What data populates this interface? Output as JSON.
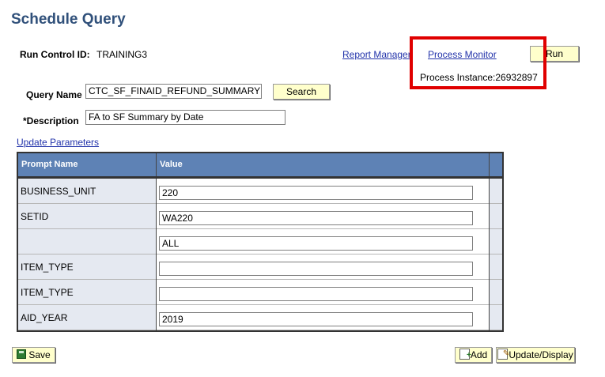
{
  "page": {
    "title": "Schedule Query"
  },
  "run_control": {
    "label": "Run Control ID:",
    "value": "TRAINING3"
  },
  "links": {
    "report_manager": "Report Manager",
    "process_monitor": "Process Monitor",
    "update_parameters": "Update Parameters"
  },
  "run_button": {
    "label": "Run"
  },
  "process_instance": {
    "text": "Process Instance:26932897"
  },
  "query_name": {
    "label": "Query Name",
    "value": "CTC_SF_FINAID_REFUND_SUMMARY"
  },
  "search_button": {
    "label": "Search"
  },
  "description": {
    "label": "*Description",
    "value": "FA to SF Summary by Date"
  },
  "grid": {
    "headers": {
      "prompt_name": "Prompt Name",
      "value": "Value"
    },
    "rows": [
      {
        "prompt": "BUSINESS_UNIT",
        "value": "220"
      },
      {
        "prompt": "SETID",
        "value": "WA220"
      },
      {
        "prompt": "",
        "value": "ALL"
      },
      {
        "prompt": "ITEM_TYPE",
        "value": ""
      },
      {
        "prompt": "ITEM_TYPE",
        "value": ""
      },
      {
        "prompt": "AID_YEAR",
        "value": "2019"
      }
    ]
  },
  "footer": {
    "save_label": "Save",
    "add_label": "Add",
    "update_label": "Update/Display"
  },
  "colors": {
    "title": "#30507a",
    "grid_header": "#5e82b5",
    "highlight": "#e00000",
    "button_bg": "#ffffcc"
  }
}
